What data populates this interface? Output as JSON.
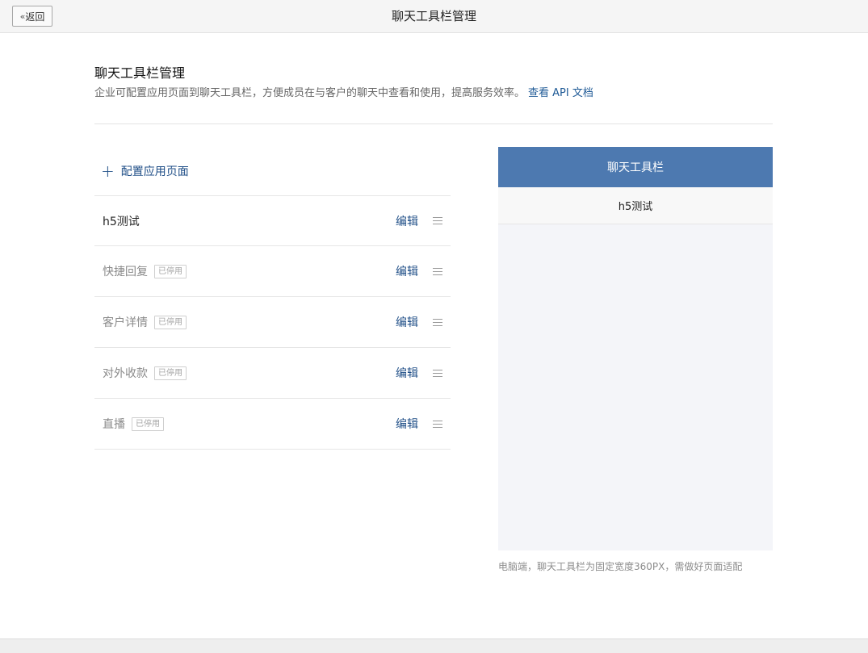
{
  "header": {
    "back_label": "返回",
    "back_icon": "chevron-double-left-icon",
    "title": "聊天工具栏管理"
  },
  "page": {
    "title": "聊天工具栏管理",
    "description": "企业可配置应用页面到聊天工具栏，方便成员在与客户的聊天中查看和使用，提高服务效率。",
    "api_link": "查看 API 文档"
  },
  "list": {
    "add_label": "配置应用页面",
    "items": [
      {
        "label": "h5测试",
        "disabled": false,
        "badge": "",
        "edit": "编辑"
      },
      {
        "label": "快捷回复",
        "disabled": true,
        "badge": "已停用",
        "edit": "编辑"
      },
      {
        "label": "客户详情",
        "disabled": true,
        "badge": "已停用",
        "edit": "编辑"
      },
      {
        "label": "对外收款",
        "disabled": true,
        "badge": "已停用",
        "edit": "编辑"
      },
      {
        "label": "直播",
        "disabled": true,
        "badge": "已停用",
        "edit": "编辑"
      }
    ]
  },
  "preview": {
    "header": "聊天工具栏",
    "items": [
      "h5测试"
    ],
    "note": "电脑端，聊天工具栏为固定宽度360PX，需做好页面适配"
  },
  "colors": {
    "accent": "#1f4e87",
    "preview_header": "#4d79b0"
  }
}
